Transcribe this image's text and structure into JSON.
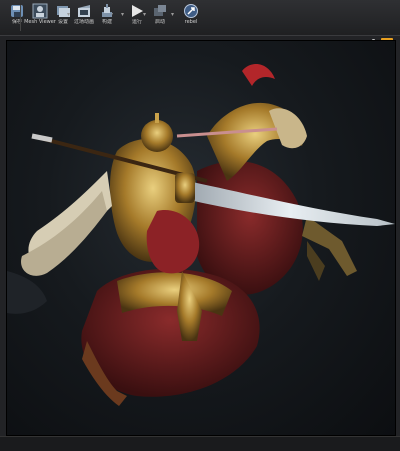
{
  "toolbar": {
    "items": [
      {
        "label": "保存",
        "icon": "save-icon"
      },
      {
        "label": "Mesh Viewer",
        "icon": "mesh-viewer-icon"
      },
      {
        "label": "设置",
        "icon": "settings-icon"
      },
      {
        "label": "过场动画",
        "icon": "cinematics-icon"
      },
      {
        "label": "构建",
        "icon": "build-icon"
      },
      {
        "label": "运行",
        "icon": "play-icon"
      },
      {
        "label": "启动",
        "icon": "launch-icon"
      },
      {
        "label": "rebel",
        "icon": "source-control-icon"
      }
    ]
  },
  "viewport": {
    "subject": "armored-general-on-rearing-horse",
    "accent_color": "#e8a020"
  }
}
